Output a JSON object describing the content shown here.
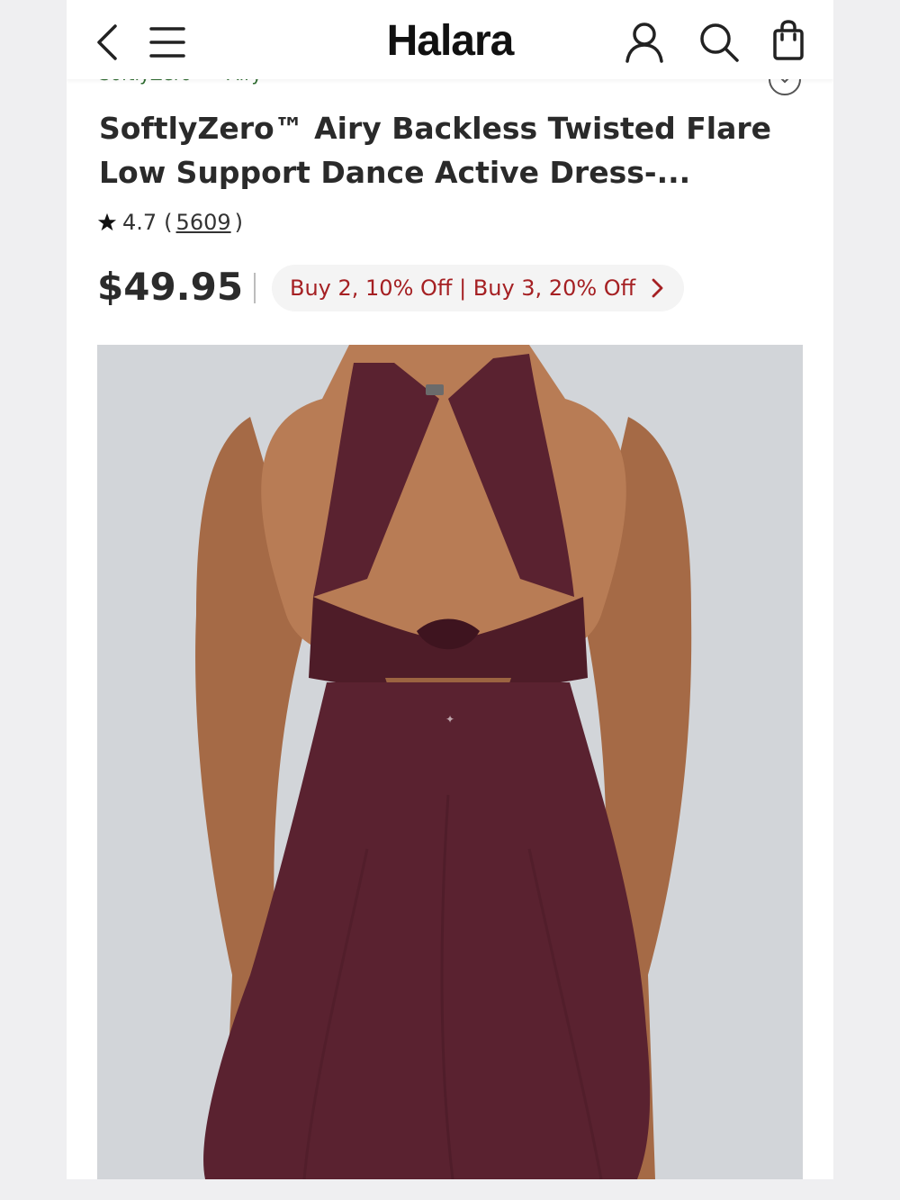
{
  "header": {
    "logo": "Halara",
    "icons": [
      "back-icon",
      "menu-icon",
      "account-icon",
      "search-icon",
      "bag-icon"
    ]
  },
  "product": {
    "breadcrumb": "SoftlyZero™ · Airy",
    "title": "SoftlyZero™ Airy Backless Twisted Flare Low Support Dance Active Dress-...",
    "rating": {
      "score": "4.7",
      "open": "(",
      "count": "5609",
      "close": ")"
    },
    "price": "$49.95",
    "promo": "Buy 2, 10% Off | Buy 3, 20% Off"
  },
  "colors": {
    "promo_text": "#a52023",
    "dress": "#5a2230",
    "photo_bg": "#d2d5d9",
    "breadcrumb": "#2d6b2f"
  }
}
